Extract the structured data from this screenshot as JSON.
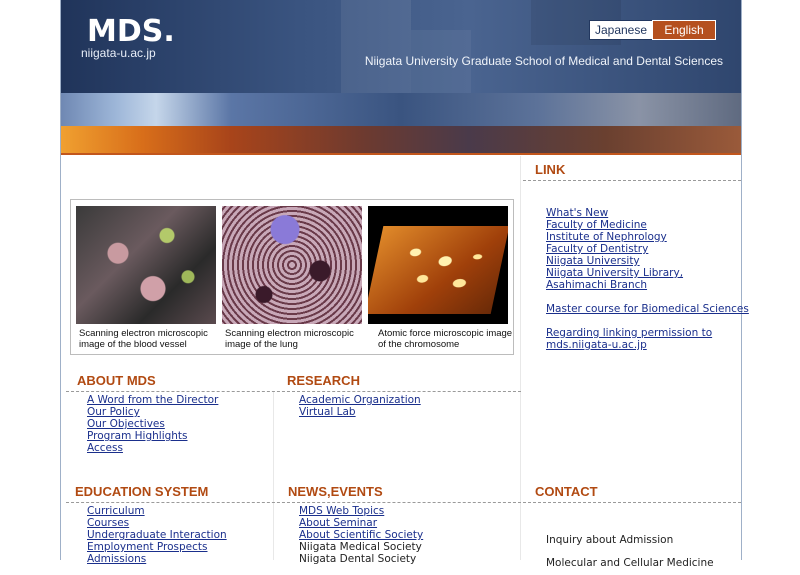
{
  "header": {
    "logo": "MDS.",
    "domain": "niigata-u.ac.jp",
    "school": "Niigata University Graduate School of Medical and Dental Sciences",
    "lang_japanese": "Japanese",
    "lang_english": "English"
  },
  "images": [
    {
      "caption": "Scanning electron microscopic image of the blood vessel"
    },
    {
      "caption": "Scanning electron microscopic image of the lung"
    },
    {
      "caption": "Atomic force microscopic image of the chromosome"
    }
  ],
  "link": {
    "heading": "LINK",
    "items": [
      "What's New",
      "Faculty of Medicine",
      "Institute of Nephrology",
      "Faculty of Dentistry",
      "Niigata University",
      "Niigata University Library,",
      "Asahimachi Branch",
      "Master course for Biomedical Sciences",
      "Regarding linking permission to",
      "mds.niigata-u.ac.jp"
    ]
  },
  "about": {
    "heading": "ABOUT MDS",
    "items": [
      "A Word from the Director",
      "Our Policy",
      "Our Objectives",
      "Program Highlights",
      "Access"
    ]
  },
  "research": {
    "heading": "RESEARCH",
    "items": [
      "Academic Organization",
      "Virtual Lab"
    ]
  },
  "education": {
    "heading": "EDUCATION SYSTEM",
    "items": [
      "Curriculum",
      "Courses",
      "Undergraduate Interaction",
      "Employment Prospects",
      "Admissions"
    ]
  },
  "news": {
    "heading": "NEWS,EVENTS",
    "items": [
      "MDS Web Topics",
      "About Seminar",
      "About Scientific Society",
      "Niigata Medical Society",
      "Niigata Dental Society"
    ]
  },
  "contact": {
    "heading": "CONTACT",
    "items": [
      "Inquiry about Admission",
      "Molecular and Cellular Medicine"
    ]
  }
}
